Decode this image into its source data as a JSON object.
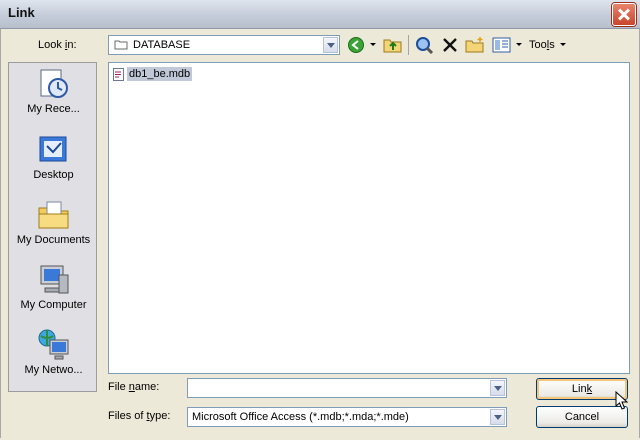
{
  "window": {
    "title": "Link"
  },
  "lookin": {
    "label_prefix": "Look ",
    "label_key": "i",
    "label_suffix": "n:",
    "value": "DATABASE"
  },
  "toolbar": {
    "tools_prefix": "Too",
    "tools_key": "l",
    "tools_suffix": "s"
  },
  "places": [
    {
      "label": "My Rece...",
      "icon": "recent-documents-icon"
    },
    {
      "label": "Desktop",
      "icon": "desktop-icon"
    },
    {
      "label": "My Documents",
      "icon": "my-documents-icon"
    },
    {
      "label": "My Computer",
      "icon": "my-computer-icon"
    },
    {
      "label": "My Netwo...",
      "icon": "network-places-icon"
    }
  ],
  "files": [
    {
      "name": "db1_be.mdb",
      "icon": "access-database-icon"
    }
  ],
  "filename": {
    "label_prefix": "File ",
    "label_key": "n",
    "label_suffix": "ame:",
    "value": ""
  },
  "filetype": {
    "label_prefix": "Files of ",
    "label_key": "t",
    "label_suffix": "ype:",
    "value": "Microsoft Office Access (*.mdb;*.mda;*.mde)"
  },
  "buttons": {
    "link_prefix": "Lin",
    "link_key": "k",
    "cancel": "Cancel"
  },
  "colors": {
    "accent": "#c9452c",
    "selection": "#c1c9d8",
    "dialog": "#ece9d8"
  }
}
